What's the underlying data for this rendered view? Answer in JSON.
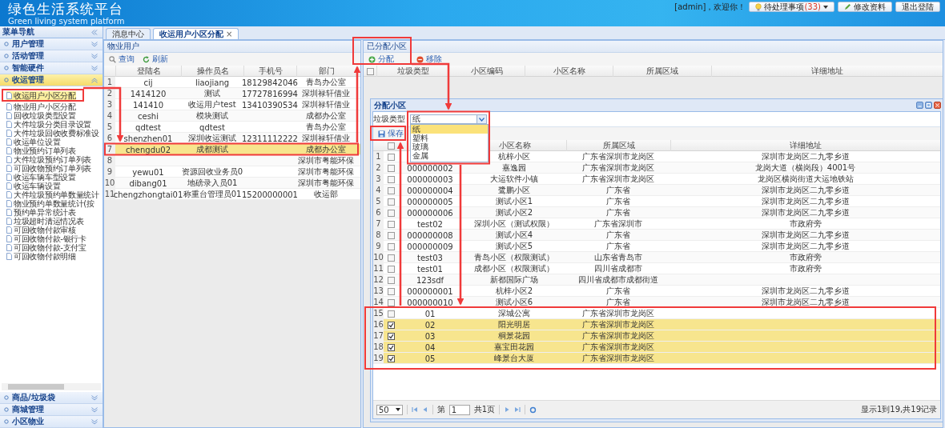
{
  "header": {
    "title": "绿色生活系统平台",
    "subtitle": "Green living system platform",
    "welcome": "[admin]，欢迎你！",
    "buttons": [
      {
        "kind": "todo",
        "label": "待处理事项",
        "count": "(33)"
      },
      {
        "kind": "edit",
        "label": "修改资料"
      },
      {
        "kind": "logout",
        "label": "退出登陆"
      }
    ]
  },
  "sidebar": {
    "title": "菜单导航",
    "sections": [
      {
        "label": "用户管理",
        "expanded": false
      },
      {
        "label": "活动管理",
        "expanded": false
      },
      {
        "label": "智能硬件",
        "expanded": false
      },
      {
        "label": "收运管理",
        "expanded": true,
        "items": [
          {
            "label": "收运用户小区分配",
            "selected": true
          },
          {
            "label": "物业用户小区分配",
            "selected": false
          },
          {
            "label": "回收垃圾类型设置",
            "selected": false
          },
          {
            "label": "大件垃圾分类目录设置",
            "selected": false
          },
          {
            "label": "大件垃圾回收收费标准设",
            "selected": false
          },
          {
            "label": "收运单位设置",
            "selected": false
          },
          {
            "label": "物业预约订单列表",
            "selected": false
          },
          {
            "label": "大件垃圾预约订单列表",
            "selected": false
          },
          {
            "label": "可回收物预约订单列表",
            "selected": false
          },
          {
            "label": "收运车辆车型设置",
            "selected": false
          },
          {
            "label": "收运车辆设置",
            "selected": false
          },
          {
            "label": "大件垃圾预约单数量统计",
            "selected": false
          },
          {
            "label": "物业预约单数量统计(按",
            "selected": false
          },
          {
            "label": "预约单异常统计表",
            "selected": false
          },
          {
            "label": "垃圾超时清运情况表",
            "selected": false
          },
          {
            "label": "可回收物付款审核",
            "selected": false
          },
          {
            "label": "可回收物付款-银行卡",
            "selected": false
          },
          {
            "label": "可回收物付款-支付宝",
            "selected": false
          },
          {
            "label": "可回收物付款明细",
            "selected": false
          }
        ]
      },
      {
        "label": "商品/垃圾袋",
        "expanded": false
      },
      {
        "label": "商城管理",
        "expanded": false
      },
      {
        "label": "小区物业",
        "expanded": false
      }
    ]
  },
  "tabs": [
    {
      "label": "消息中心",
      "selected": false
    },
    {
      "label": "收运用户小区分配",
      "selected": true,
      "close": "×"
    }
  ],
  "users_panel": {
    "title": "物业用户",
    "tools": [
      {
        "kind": "search",
        "label": "查询"
      },
      {
        "kind": "refresh",
        "label": "刷新"
      }
    ],
    "columns": [
      "登陆名",
      "操作员名",
      "手机号",
      "部门"
    ],
    "rows": [
      {
        "num": "1",
        "selected": false,
        "cells": [
          "cij",
          "liaojiang",
          "18129842046",
          "青岛办公室"
        ]
      },
      {
        "num": "2",
        "selected": false,
        "cells": [
          "1414120",
          "测试",
          "17727816994",
          "深圳禄轩借业"
        ]
      },
      {
        "num": "3",
        "selected": false,
        "cells": [
          "141410",
          "收运用户test",
          "13410390534",
          "深圳禄轩借业"
        ]
      },
      {
        "num": "4",
        "selected": false,
        "cells": [
          "ceshi",
          "模块测试",
          null,
          "成都办公室"
        ]
      },
      {
        "num": "5",
        "selected": false,
        "cells": [
          "qdtest",
          "qdtest",
          null,
          "青岛办公室"
        ]
      },
      {
        "num": "6",
        "selected": false,
        "cells": [
          "shenzhen01",
          "深圳收运测试",
          "12311112222",
          "深圳禄轩借业"
        ]
      },
      {
        "num": "7",
        "selected": true,
        "cells": [
          "chengdu02",
          "成都测试",
          null,
          "成都办公室"
        ]
      },
      {
        "num": "8",
        "selected": false,
        "cells": [
          null,
          null,
          null,
          "深圳市粤能环保"
        ]
      },
      {
        "num": "9",
        "selected": false,
        "cells": [
          "yewu01",
          "资源回收业务员0",
          null,
          "深圳市粤能环保"
        ]
      },
      {
        "num": "10",
        "selected": false,
        "cells": [
          "dibang01",
          "地磅录入员01",
          null,
          "深圳市粤能环保"
        ]
      },
      {
        "num": "11",
        "selected": false,
        "cells": [
          "chengzhongtai01",
          "称重台管理员01",
          "15200000001",
          "收运部"
        ]
      }
    ]
  },
  "assigned_panel": {
    "title": "已分配小区",
    "tools": [
      {
        "kind": "add",
        "label": "分配"
      },
      {
        "kind": "remove",
        "label": "移除"
      }
    ],
    "all_checked": false,
    "columns": [
      "垃圾类型",
      "小区编码",
      "小区名称",
      "所属区域",
      "详细地址"
    ]
  },
  "dialog": {
    "title": "分配小区",
    "filter": {
      "label": "垃圾类型",
      "value": "纸",
      "options": [
        {
          "label": "纸",
          "selected": true
        },
        {
          "label": "塑料",
          "selected": false
        },
        {
          "label": "玻璃",
          "selected": false
        },
        {
          "label": "金属",
          "selected": false
        }
      ]
    },
    "tools": [
      {
        "kind": "save",
        "label": "保存"
      }
    ],
    "all_checked": false,
    "columns": [
      "小区名称",
      "所属区域",
      "详细地址"
    ],
    "rows": [
      {
        "num": "1",
        "checked": false,
        "code": null,
        "name": "杭梓小区",
        "region": "广东省深圳市龙岗区",
        "address": "深圳市龙岗区二九零乡道"
      },
      {
        "num": "2",
        "checked": false,
        "code": "000000002",
        "name": "嘉逸园",
        "region": "广东省深圳市龙岗区",
        "address": "龙岗大道（横岗段）4001号"
      },
      {
        "num": "3",
        "checked": false,
        "code": "000000003",
        "name": "大运软件小镇",
        "region": "广东省深圳市龙岗区",
        "address": "龙岗区横岗街道大运地铁站"
      },
      {
        "num": "4",
        "checked": false,
        "code": "000000004",
        "name": "鹭鹏小区",
        "region": "广东省",
        "address": "深圳市龙岗区二九零乡道"
      },
      {
        "num": "5",
        "checked": false,
        "code": "000000005",
        "name": "测试小区1",
        "region": "广东省",
        "address": "深圳市龙岗区二九零乡道"
      },
      {
        "num": "6",
        "checked": false,
        "code": "000000006",
        "name": "测试小区2",
        "region": "广东省",
        "address": "深圳市龙岗区二九零乡道"
      },
      {
        "num": "7",
        "checked": false,
        "code": "test02",
        "name": "深圳小区（测试权限）",
        "region": "广东省深圳市",
        "address": "市政府旁"
      },
      {
        "num": "8",
        "checked": false,
        "code": "000000008",
        "name": "测试小区4",
        "region": "广东省",
        "address": "深圳市龙岗区二九零乡道"
      },
      {
        "num": "9",
        "checked": false,
        "code": "000000009",
        "name": "测试小区5",
        "region": "广东省",
        "address": "深圳市龙岗区二九零乡道"
      },
      {
        "num": "10",
        "checked": false,
        "code": "test03",
        "name": "青岛小区（权限测试）",
        "region": "山东省青岛市",
        "address": "市政府旁"
      },
      {
        "num": "11",
        "checked": false,
        "code": "test01",
        "name": "成都小区（权限测试）",
        "region": "四川省成都市",
        "address": "市政府旁"
      },
      {
        "num": "12",
        "checked": false,
        "code": "123sdf",
        "name": "新都国际广场",
        "region": "四川省成都市成都街道",
        "address": null
      },
      {
        "num": "13",
        "checked": false,
        "code": "000000001",
        "name": "杭梓小区2",
        "region": "广东省",
        "address": "深圳市龙岗区二九零乡道"
      },
      {
        "num": "14",
        "checked": false,
        "code": "000000010",
        "name": "测试小区6",
        "region": "广东省",
        "address": "深圳市龙岗区二九零乡道"
      },
      {
        "num": "15",
        "checked": false,
        "code": "01",
        "name": "深城公寓",
        "region": "广东省深圳市龙岗区",
        "address": null
      },
      {
        "num": "16",
        "checked": true,
        "code": "02",
        "name": "阳光明居",
        "region": "广东省深圳市龙岗区",
        "address": null
      },
      {
        "num": "17",
        "checked": true,
        "code": "03",
        "name": "桐景花园",
        "region": "广东省深圳市龙岗区",
        "address": null
      },
      {
        "num": "18",
        "checked": true,
        "code": "04",
        "name": "嘉宝田花园",
        "region": "广东省深圳市龙岗区",
        "address": null
      },
      {
        "num": "19",
        "checked": true,
        "code": "05",
        "name": "峰景台大厦",
        "region": "广东省深圳市龙岗区",
        "address": null
      }
    ],
    "pager": {
      "page_size": "50",
      "page_label": "第",
      "page": "1",
      "total_pages": "共1页",
      "summary": "显示1到19,共19记录"
    }
  }
}
